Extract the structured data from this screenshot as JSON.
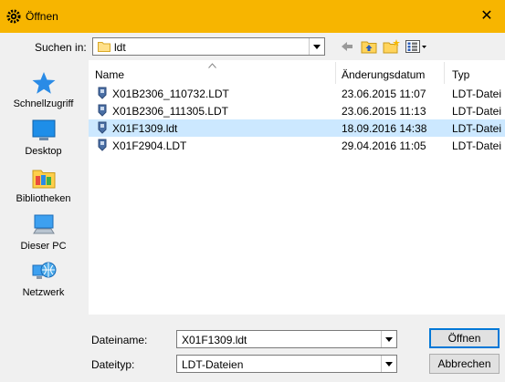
{
  "window": {
    "title": "Öffnen",
    "close_glyph": "✕"
  },
  "lookin": {
    "label": "Suchen in:",
    "value": "ldt"
  },
  "places": [
    {
      "label": "Schnellzugriff",
      "icon": "star-icon"
    },
    {
      "label": "Desktop",
      "icon": "desktop-icon"
    },
    {
      "label": "Bibliotheken",
      "icon": "library-icon"
    },
    {
      "label": "Dieser PC",
      "icon": "computer-icon"
    },
    {
      "label": "Netzwerk",
      "icon": "network-icon"
    }
  ],
  "columns": {
    "name": "Name",
    "date": "Änderungsdatum",
    "type": "Typ"
  },
  "files": [
    {
      "name": "X01B2306_110732.LDT",
      "date": "23.06.2015 11:07",
      "type": "LDT-Datei",
      "selected": false
    },
    {
      "name": "X01B2306_111305.LDT",
      "date": "23.06.2015 11:13",
      "type": "LDT-Datei",
      "selected": false
    },
    {
      "name": "X01F1309.ldt",
      "date": "18.09.2016 14:38",
      "type": "LDT-Datei",
      "selected": true
    },
    {
      "name": "X01F2904.LDT",
      "date": "29.04.2016 11:05",
      "type": "LDT-Datei",
      "selected": false
    }
  ],
  "filename": {
    "label": "Dateiname:",
    "value": "X01F1309.ldt"
  },
  "filetype": {
    "label": "Dateityp:",
    "value": "LDT-Dateien"
  },
  "buttons": {
    "open": "Öffnen",
    "cancel": "Abbrechen"
  },
  "colors": {
    "titlebar": "#f7b500",
    "selection": "#cce8ff",
    "primary_border": "#0078d7"
  }
}
